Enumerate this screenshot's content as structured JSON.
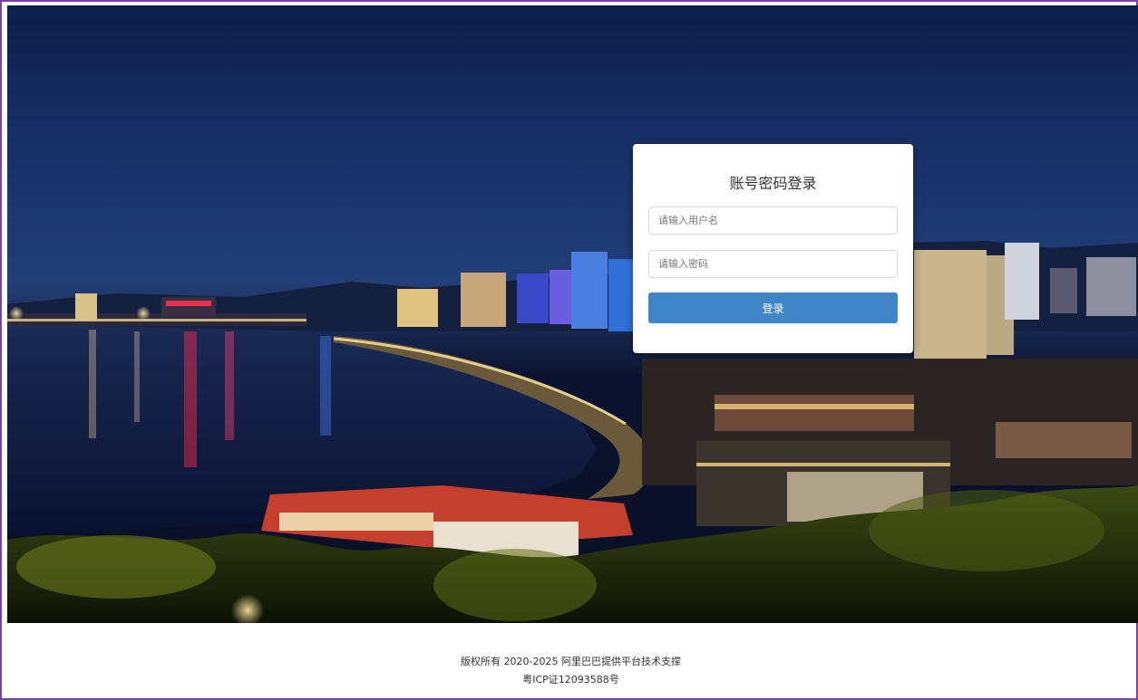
{
  "login": {
    "title": "账号密码登录",
    "username_placeholder": "请输入用户名",
    "password_placeholder": "请输入密码",
    "submit_label": "登录"
  },
  "footer": {
    "copyright": "版权所有 2020-2025 阿里巴巴提供平台技术支撑",
    "icp": "粤ICP证12093588号"
  },
  "colors": {
    "accent": "#3f86c9",
    "frame_border": "#7a3fb0"
  }
}
